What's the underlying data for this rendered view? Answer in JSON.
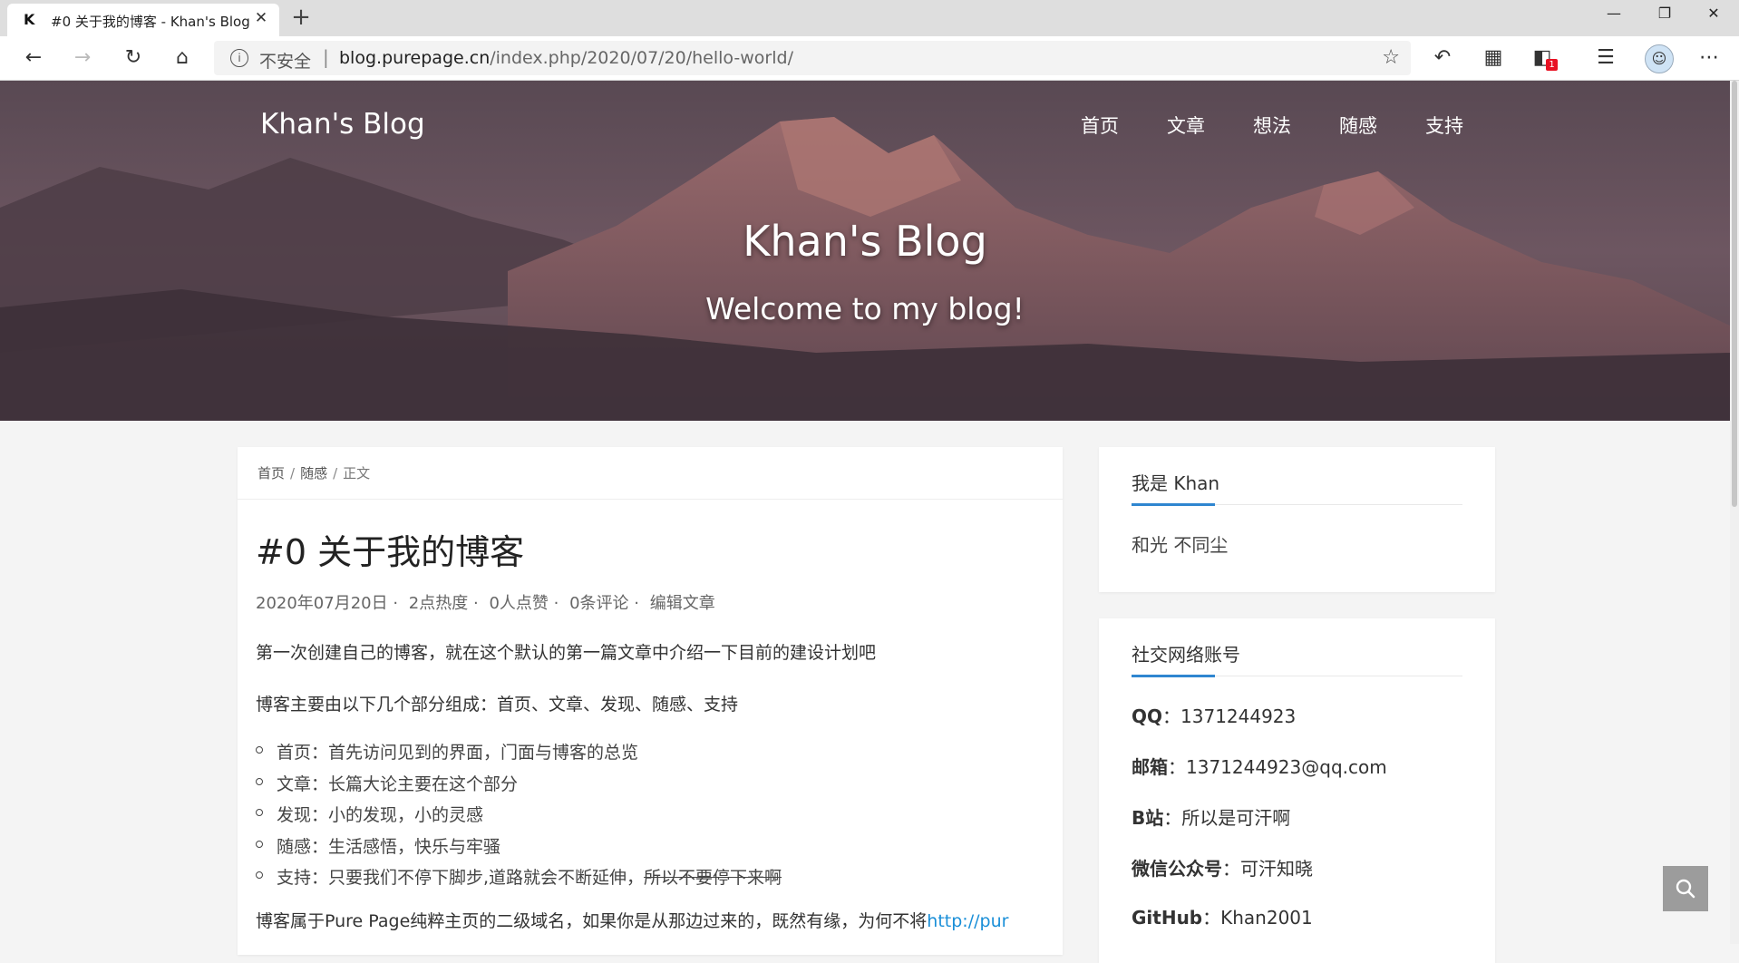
{
  "browser": {
    "tab_title": "#0 关于我的博客 - Khan's Blog",
    "favicon": "K",
    "security_label": "不安全",
    "url_host": "blog.purepage.cn",
    "url_path": "/index.php/2020/07/20/hello-world/",
    "badge_count": "1"
  },
  "header": {
    "site_title": "Khan's Blog",
    "nav": [
      "首页",
      "文章",
      "想法",
      "随感",
      "支持"
    ],
    "hero_title": "Khan's Blog",
    "hero_subtitle": "Welcome to my blog!"
  },
  "breadcrumb": [
    "首页",
    "随感",
    "正文"
  ],
  "post": {
    "title": "#0 关于我的博客",
    "meta": [
      "2020年07月20日 ·",
      "2点热度 ·",
      "0人点赞 ·",
      "0条评论 ·",
      "编辑文章"
    ],
    "intro": "第一次创建自己的博客，就在这个默认的第一篇文章中介绍一下目前的建设计划吧",
    "parts_heading": "博客主要由以下几个部分组成：首页、文章、发现、随感、支持",
    "parts": [
      "首页：首先访问见到的界面，门面与博客的总览",
      "文章：长篇大论主要在这个部分",
      "发现：小的发现，小的灵感",
      "随感：生活感悟，快乐与牢骚",
      "支持：只要我们不停下脚步,道路就会不断延伸，"
    ],
    "parts_strike": "所以不要停下来啊",
    "footer_text": "博客属于Pure Page纯粹主页的二级域名，如果你是从那边过来的，既然有缘，为何不将",
    "footer_link": "http://pur"
  },
  "sidebar": {
    "about_title": "我是 Khan",
    "motto": "和光 不同尘",
    "social_title": "社交网络账号",
    "social": [
      {
        "label": "QQ",
        "value": "：1371244923"
      },
      {
        "label": "邮箱",
        "value": "：1371244923@qq.com"
      },
      {
        "label": "B站",
        "value": "：所以是可汗啊"
      },
      {
        "label": "微信公众号",
        "value": "：可汗知晓"
      },
      {
        "label": "GitHub",
        "value": "：Khan2001"
      }
    ]
  },
  "icons": {
    "back": "back-icon",
    "forward": "forward-icon",
    "refresh": "refresh-icon",
    "home": "home-icon",
    "info": "info-icon",
    "favorite": "star-icon",
    "search": "search-icon"
  },
  "colors": {
    "accent": "#2f86d0",
    "link": "#1a8fd8",
    "badge": "#e81123",
    "hero": "#6b5460"
  }
}
